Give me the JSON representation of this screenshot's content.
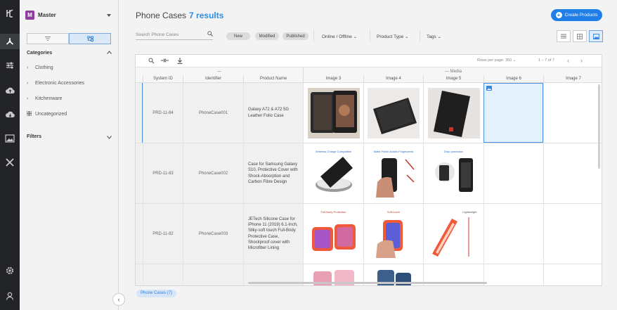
{
  "sidebar": {
    "workspace": "Master",
    "workspace_initial": "M",
    "categories_label": "Categories",
    "categories": [
      {
        "label": "Clothing",
        "icon": "chevron-right-icon"
      },
      {
        "label": "Electronic Accessories",
        "icon": "chevron-right-icon"
      },
      {
        "label": "Kitchenware",
        "icon": "chevron-right-icon"
      },
      {
        "label": "Uncategorized",
        "icon": "grid-icon"
      }
    ],
    "filters_label": "Filters"
  },
  "header": {
    "title": "Phone Cases",
    "count": "7 results",
    "create_label": "Create Products"
  },
  "filters": {
    "search_placeholder": "Search Phone Cases",
    "chips": [
      "New",
      "Modified",
      "Published"
    ],
    "dropdowns": [
      "Online / Offline",
      "Product Type",
      "Tags"
    ]
  },
  "grid": {
    "rows_per_page_label": "Rows per page:",
    "rows_per_page": "350",
    "range": "1 – 7 of 7",
    "group_left": "—",
    "group_media": "— Media",
    "columns": [
      "System ID",
      "Identifier",
      "Product Name",
      "Image 3",
      "Image 4",
      "Image 5",
      "Image 6",
      "Image 7"
    ],
    "rows": [
      {
        "system_id": "PRD-11-84",
        "identifier": "PhoneCase001",
        "name": "Galaxy A72 & A72 5G Leather Folio Case"
      },
      {
        "system_id": "PRD-11-83",
        "identifier": "PhoneCase002",
        "name": "Case for Samsung Galaxy S10, Protective Cover with Shock-Absorption and Carbon Fibre Design"
      },
      {
        "system_id": "PRD-11-82",
        "identifier": "PhoneCase003",
        "name": "JETech Silicone Case for iPhone 11 (2019) 6.1-Inch, Silky-soft touch Full-Body Protective Case, Shockproof cover with Microfiber Lining"
      }
    ],
    "image_captions_row2": [
      "Wireless Charge Compatible",
      "Matte Finish Avoids Fingerprints",
      "Drop protection"
    ],
    "image_captions_row3": [
      "Full-Body Protection",
      "Soft-touch",
      "Lightweight"
    ]
  },
  "footer": {
    "tab_label": "Phone Cases (7)"
  },
  "colors": {
    "accent": "#1f7fe6",
    "rail": "#222427",
    "workspace_logo": "#8e3c9e",
    "selected_cell": "#4a90e2"
  }
}
